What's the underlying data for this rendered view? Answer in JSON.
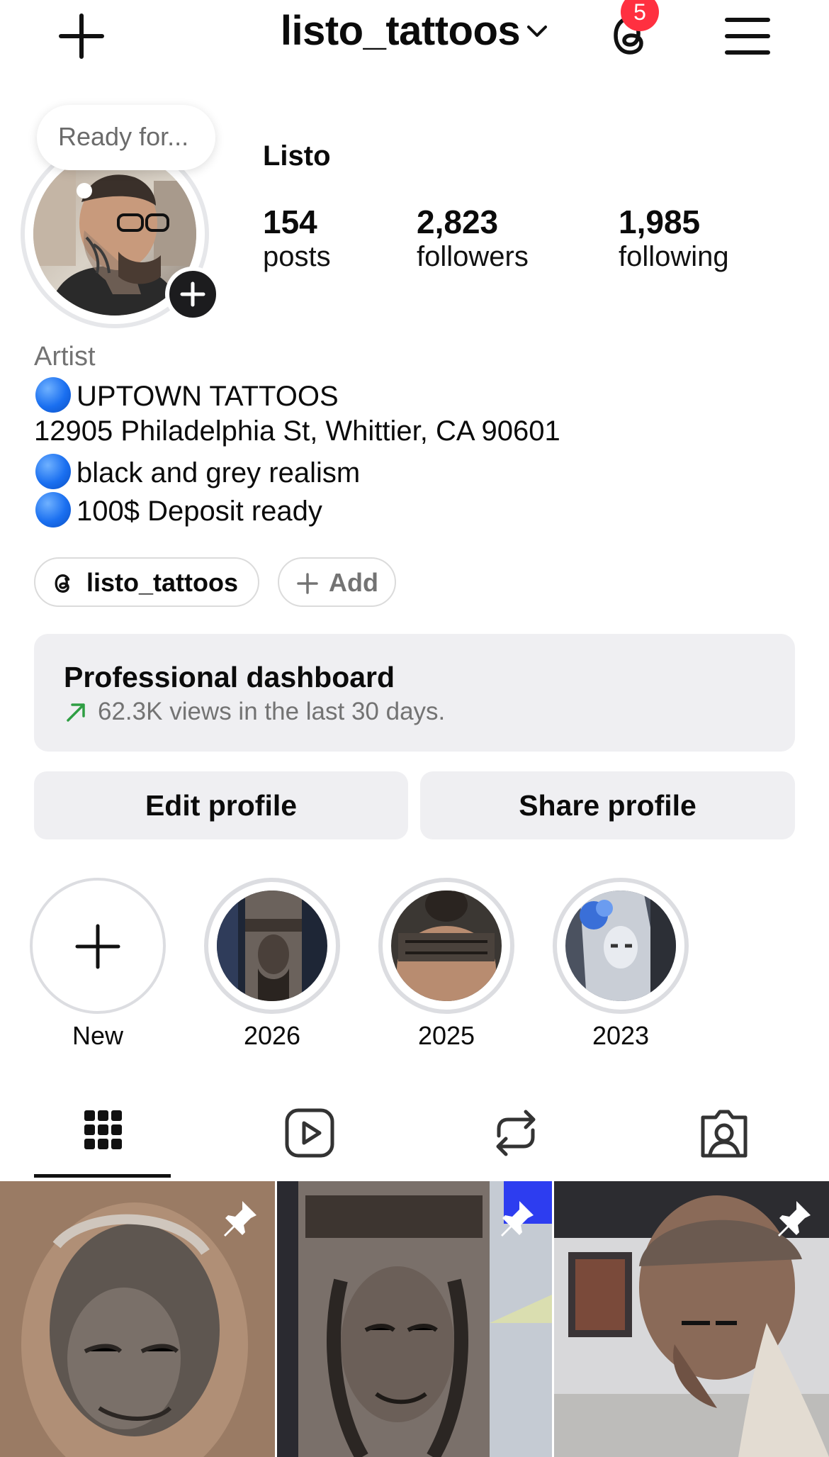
{
  "header": {
    "username": "listo_tattoos",
    "threads_badge_count": "5"
  },
  "profile": {
    "note": "Ready for...",
    "display_name": "Listo",
    "stats": {
      "posts_count": "154",
      "posts_label": "posts",
      "followers_count": "2,823",
      "followers_label": "followers",
      "following_count": "1,985",
      "following_label": "following"
    },
    "category": "Artist",
    "bio_lines": [
      "UPTOWN TATTOOS",
      "12905 Philadelphia St, Whittier, CA 90601",
      "black and grey realism",
      "100$ Deposit ready"
    ],
    "threads_link": "listo_tattoos",
    "add_link": "Add"
  },
  "dashboard": {
    "title": "Professional dashboard",
    "subtitle": "62.3K views in the last 30 days."
  },
  "buttons": {
    "edit": "Edit profile",
    "share": "Share profile"
  },
  "highlights": [
    {
      "label": "New"
    },
    {
      "label": "2026"
    },
    {
      "label": "2025"
    },
    {
      "label": "2023"
    }
  ],
  "tabs": [
    {
      "icon": "grid-icon",
      "selected": true
    },
    {
      "icon": "reels-icon",
      "selected": false
    },
    {
      "icon": "reposts-icon",
      "selected": false
    },
    {
      "icon": "tagged-icon",
      "selected": false
    }
  ],
  "colors": {
    "badge": "#ff3040",
    "bio_dot": "#1a6ff0",
    "dashboard_arrow": "#2e9e43",
    "button_bg": "#efeff2"
  }
}
